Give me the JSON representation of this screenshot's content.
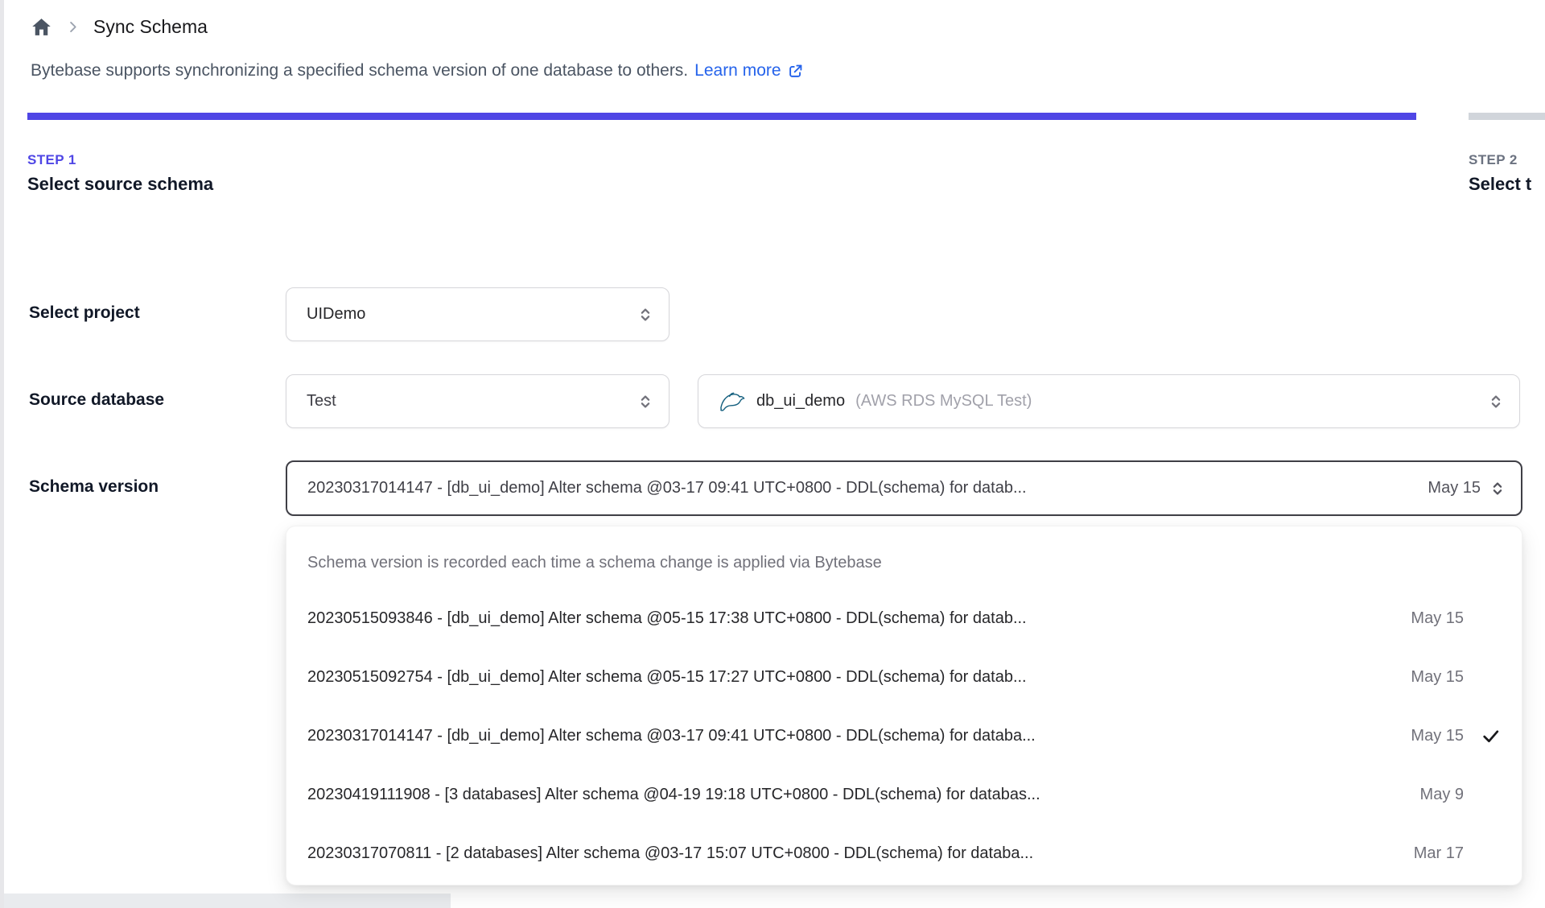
{
  "breadcrumb": {
    "title": "Sync Schema"
  },
  "description": {
    "text": "Bytebase supports synchronizing a specified schema version of one database to others.",
    "link_label": "Learn more"
  },
  "colors": {
    "accent_indigo": "#4f46e5",
    "inactive_gray": "#d1d5db",
    "link_blue": "#2563eb"
  },
  "steps": [
    {
      "step": "STEP 1",
      "title": "Select source schema",
      "active": true
    },
    {
      "step": "STEP 2",
      "title": "Select t",
      "active": false
    }
  ],
  "form": {
    "project": {
      "label": "Select project",
      "value": "UIDemo"
    },
    "source_database": {
      "label": "Source database",
      "environment_value": "Test",
      "database_value": "db_ui_demo",
      "database_detail": "(AWS RDS MySQL Test)"
    },
    "schema_version": {
      "label": "Schema version",
      "value": "20230317014147 - [db_ui_demo] Alter schema @03-17 09:41 UTC+0800 - DDL(schema) for datab...",
      "date": "May 15"
    }
  },
  "dropdown": {
    "hint": "Schema version is recorded each time a schema change is applied via Bytebase",
    "options": [
      {
        "text": "20230515093846 - [db_ui_demo] Alter schema @05-15 17:38 UTC+0800 - DDL(schema) for datab...",
        "date": "May 15",
        "selected": false
      },
      {
        "text": "20230515092754 - [db_ui_demo] Alter schema @05-15 17:27 UTC+0800 - DDL(schema) for datab...",
        "date": "May 15",
        "selected": false
      },
      {
        "text": "20230317014147 - [db_ui_demo] Alter schema @03-17 09:41 UTC+0800 - DDL(schema) for databa...",
        "date": "May 15",
        "selected": true
      },
      {
        "text": "20230419111908 - [3 databases] Alter schema @04-19 19:18 UTC+0800 - DDL(schema) for databas...",
        "date": "May 9",
        "selected": false
      },
      {
        "text": "20230317070811 - [2 databases] Alter schema @03-17 15:07 UTC+0800 - DDL(schema) for databa...",
        "date": "Mar 17",
        "selected": false
      }
    ]
  }
}
